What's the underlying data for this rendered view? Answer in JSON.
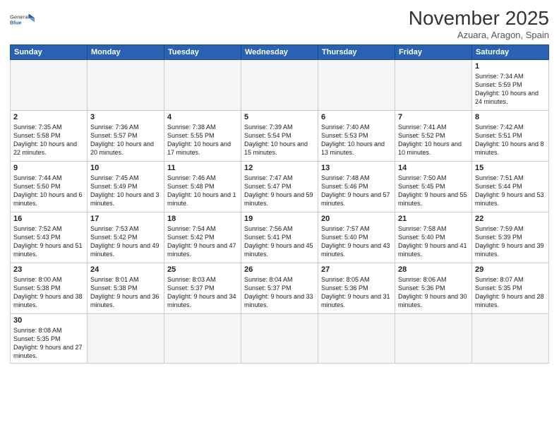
{
  "logo": {
    "general": "General",
    "blue": "Blue"
  },
  "title": "November 2025",
  "location": "Azuara, Aragon, Spain",
  "weekdays": [
    "Sunday",
    "Monday",
    "Tuesday",
    "Wednesday",
    "Thursday",
    "Friday",
    "Saturday"
  ],
  "weeks": [
    [
      {
        "day": "",
        "info": ""
      },
      {
        "day": "",
        "info": ""
      },
      {
        "day": "",
        "info": ""
      },
      {
        "day": "",
        "info": ""
      },
      {
        "day": "",
        "info": ""
      },
      {
        "day": "",
        "info": ""
      },
      {
        "day": "1",
        "info": "Sunrise: 7:34 AM\nSunset: 5:59 PM\nDaylight: 10 hours and 24 minutes."
      }
    ],
    [
      {
        "day": "2",
        "info": "Sunrise: 7:35 AM\nSunset: 5:58 PM\nDaylight: 10 hours and 22 minutes."
      },
      {
        "day": "3",
        "info": "Sunrise: 7:36 AM\nSunset: 5:57 PM\nDaylight: 10 hours and 20 minutes."
      },
      {
        "day": "4",
        "info": "Sunrise: 7:38 AM\nSunset: 5:55 PM\nDaylight: 10 hours and 17 minutes."
      },
      {
        "day": "5",
        "info": "Sunrise: 7:39 AM\nSunset: 5:54 PM\nDaylight: 10 hours and 15 minutes."
      },
      {
        "day": "6",
        "info": "Sunrise: 7:40 AM\nSunset: 5:53 PM\nDaylight: 10 hours and 13 minutes."
      },
      {
        "day": "7",
        "info": "Sunrise: 7:41 AM\nSunset: 5:52 PM\nDaylight: 10 hours and 10 minutes."
      },
      {
        "day": "8",
        "info": "Sunrise: 7:42 AM\nSunset: 5:51 PM\nDaylight: 10 hours and 8 minutes."
      }
    ],
    [
      {
        "day": "9",
        "info": "Sunrise: 7:44 AM\nSunset: 5:50 PM\nDaylight: 10 hours and 6 minutes."
      },
      {
        "day": "10",
        "info": "Sunrise: 7:45 AM\nSunset: 5:49 PM\nDaylight: 10 hours and 3 minutes."
      },
      {
        "day": "11",
        "info": "Sunrise: 7:46 AM\nSunset: 5:48 PM\nDaylight: 10 hours and 1 minute."
      },
      {
        "day": "12",
        "info": "Sunrise: 7:47 AM\nSunset: 5:47 PM\nDaylight: 9 hours and 59 minutes."
      },
      {
        "day": "13",
        "info": "Sunrise: 7:48 AM\nSunset: 5:46 PM\nDaylight: 9 hours and 57 minutes."
      },
      {
        "day": "14",
        "info": "Sunrise: 7:50 AM\nSunset: 5:45 PM\nDaylight: 9 hours and 55 minutes."
      },
      {
        "day": "15",
        "info": "Sunrise: 7:51 AM\nSunset: 5:44 PM\nDaylight: 9 hours and 53 minutes."
      }
    ],
    [
      {
        "day": "16",
        "info": "Sunrise: 7:52 AM\nSunset: 5:43 PM\nDaylight: 9 hours and 51 minutes."
      },
      {
        "day": "17",
        "info": "Sunrise: 7:53 AM\nSunset: 5:42 PM\nDaylight: 9 hours and 49 minutes."
      },
      {
        "day": "18",
        "info": "Sunrise: 7:54 AM\nSunset: 5:42 PM\nDaylight: 9 hours and 47 minutes."
      },
      {
        "day": "19",
        "info": "Sunrise: 7:56 AM\nSunset: 5:41 PM\nDaylight: 9 hours and 45 minutes."
      },
      {
        "day": "20",
        "info": "Sunrise: 7:57 AM\nSunset: 5:40 PM\nDaylight: 9 hours and 43 minutes."
      },
      {
        "day": "21",
        "info": "Sunrise: 7:58 AM\nSunset: 5:40 PM\nDaylight: 9 hours and 41 minutes."
      },
      {
        "day": "22",
        "info": "Sunrise: 7:59 AM\nSunset: 5:39 PM\nDaylight: 9 hours and 39 minutes."
      }
    ],
    [
      {
        "day": "23",
        "info": "Sunrise: 8:00 AM\nSunset: 5:38 PM\nDaylight: 9 hours and 38 minutes."
      },
      {
        "day": "24",
        "info": "Sunrise: 8:01 AM\nSunset: 5:38 PM\nDaylight: 9 hours and 36 minutes."
      },
      {
        "day": "25",
        "info": "Sunrise: 8:03 AM\nSunset: 5:37 PM\nDaylight: 9 hours and 34 minutes."
      },
      {
        "day": "26",
        "info": "Sunrise: 8:04 AM\nSunset: 5:37 PM\nDaylight: 9 hours and 33 minutes."
      },
      {
        "day": "27",
        "info": "Sunrise: 8:05 AM\nSunset: 5:36 PM\nDaylight: 9 hours and 31 minutes."
      },
      {
        "day": "28",
        "info": "Sunrise: 8:06 AM\nSunset: 5:36 PM\nDaylight: 9 hours and 30 minutes."
      },
      {
        "day": "29",
        "info": "Sunrise: 8:07 AM\nSunset: 5:35 PM\nDaylight: 9 hours and 28 minutes."
      }
    ],
    [
      {
        "day": "30",
        "info": "Sunrise: 8:08 AM\nSunset: 5:35 PM\nDaylight: 9 hours and 27 minutes."
      },
      {
        "day": "",
        "info": ""
      },
      {
        "day": "",
        "info": ""
      },
      {
        "day": "",
        "info": ""
      },
      {
        "day": "",
        "info": ""
      },
      {
        "day": "",
        "info": ""
      },
      {
        "day": "",
        "info": ""
      }
    ]
  ]
}
